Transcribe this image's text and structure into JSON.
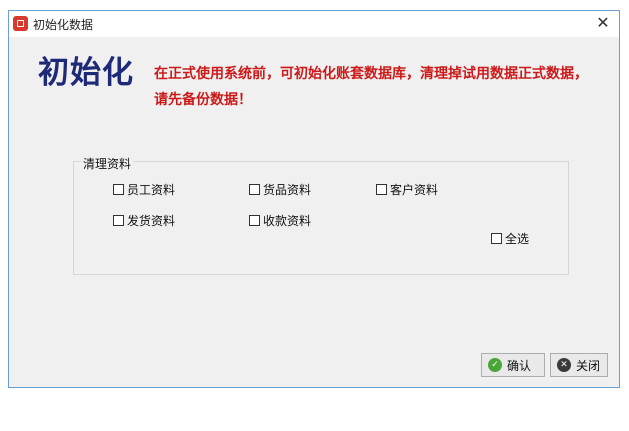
{
  "window": {
    "title": "初始化数据"
  },
  "header": {
    "big_title": "初始化",
    "warning": "在正式使用系统前，可初始化账套数据库，清理掉试用数据正式数据，请先备份数据！"
  },
  "group": {
    "label": "清理资料",
    "items": [
      {
        "label": "员工资料",
        "checked": false
      },
      {
        "label": "货品资料",
        "checked": false
      },
      {
        "label": "客户资料",
        "checked": false
      },
      {
        "label": "发货资料",
        "checked": false
      },
      {
        "label": "收款资料",
        "checked": false
      }
    ],
    "select_all": {
      "label": "全选",
      "checked": false
    }
  },
  "buttons": {
    "ok": "确认",
    "close": "关闭"
  },
  "icons": {
    "app": "app-icon",
    "close": "close-icon",
    "ok": "check-circle-icon",
    "cancel": "x-circle-icon"
  },
  "colors": {
    "title": "#1e2a78",
    "warning": "#cc1a1a",
    "window_border": "#6a9fd0"
  }
}
